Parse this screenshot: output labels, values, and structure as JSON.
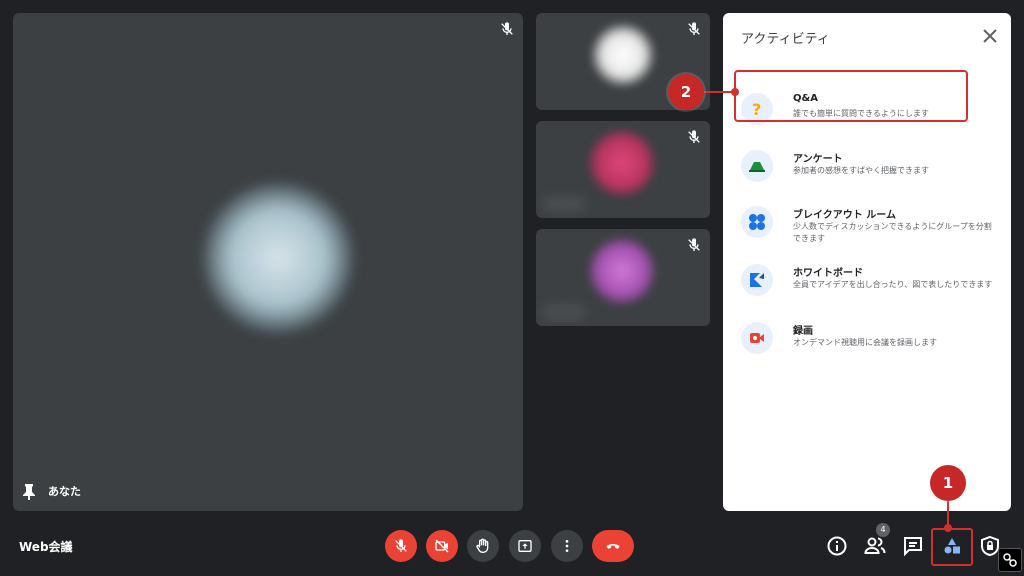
{
  "tiles": {
    "main_name": "あなた"
  },
  "panel": {
    "title": "アクティビティ",
    "items": [
      {
        "title": "Q&A",
        "desc": "誰でも簡単に質問できるようにします"
      },
      {
        "title": "アンケート",
        "desc": "参加者の感想をすばやく把握できます"
      },
      {
        "title": "ブレイクアウト ルーム",
        "desc": "少人数でディスカッションできるようにグループを分割できます"
      },
      {
        "title": "ホワイトボード",
        "desc": "全員でアイデアを出し合ったり、図で表したりできます"
      },
      {
        "title": "録画",
        "desc": "オンデマンド視聴用に会議を録画します"
      }
    ]
  },
  "annotations": {
    "step1": "1",
    "step2": "2"
  },
  "bottom_bar": {
    "meeting_title": "Web会議",
    "participant_count": "4"
  },
  "colors": {
    "background": "#202124",
    "tile": "#3c4043",
    "danger": "#ea4335",
    "annotation": "#d32f2f"
  }
}
